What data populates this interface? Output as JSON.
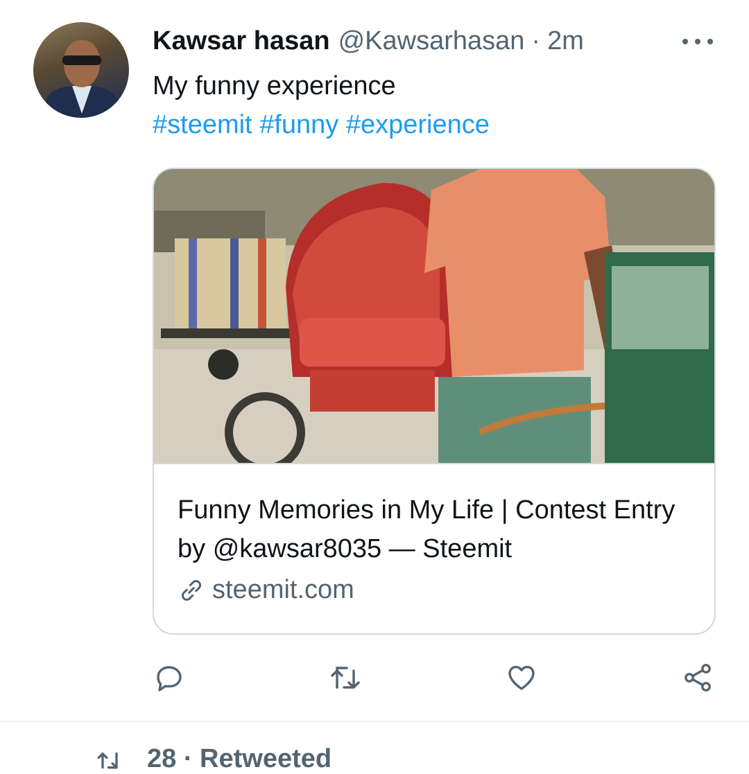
{
  "tweet": {
    "author": {
      "display_name": "Kawsar hasan",
      "handle": "@Kawsarhasan",
      "separator": "·",
      "time": "2m"
    },
    "text": "My funny experience",
    "hashtags": [
      "#steemit",
      "#funny",
      "#experience"
    ]
  },
  "card": {
    "title": "Funny Memories in My Life | Contest Entry by @kawsar8035 — Steemit",
    "domain": "steemit.com",
    "image_alt": "Rickshaw puller in orange shirt on a street"
  },
  "actions": {
    "reply_icon": "reply-icon",
    "retweet_icon": "retweet-icon",
    "like_icon": "heart-icon",
    "share_icon": "share-icon"
  },
  "footer": {
    "retweeted_text": "28   · Retweeted"
  },
  "colors": {
    "link": "#1d9bf0",
    "secondary_text": "#536471",
    "border": "#cfd9de"
  }
}
